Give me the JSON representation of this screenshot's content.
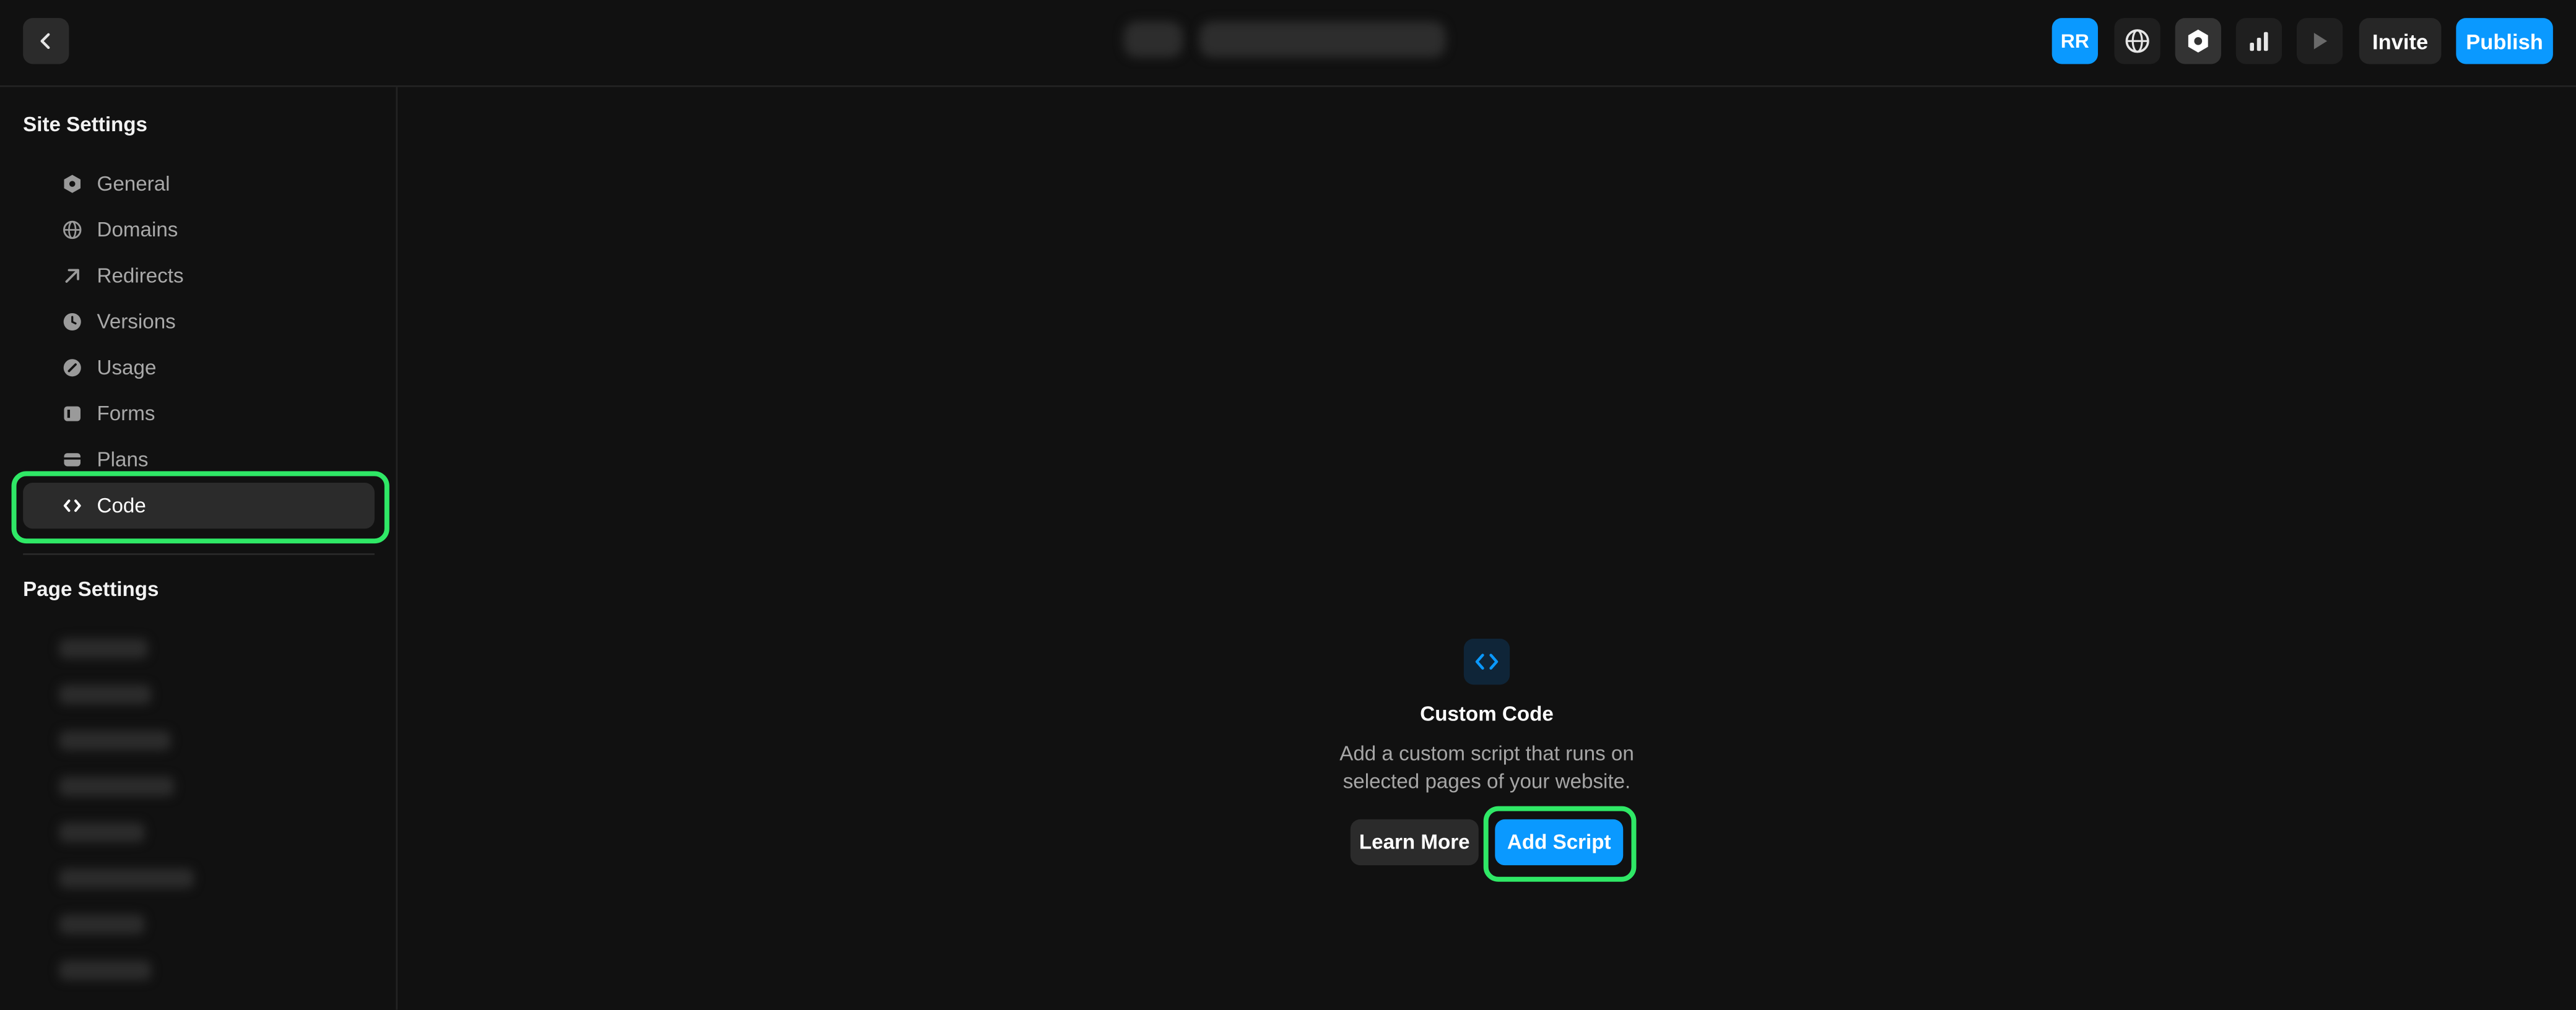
{
  "header": {
    "avatar_initials": "RR",
    "invite_label": "Invite",
    "publish_label": "Publish",
    "icons": [
      "back-icon",
      "globe-icon",
      "settings-hexagon-icon",
      "analytics-bars-icon",
      "preview-play-icon"
    ]
  },
  "sidebar": {
    "site_settings_title": "Site Settings",
    "items": [
      {
        "label": "General",
        "icon": "hexagon-icon"
      },
      {
        "label": "Domains",
        "icon": "globe-icon"
      },
      {
        "label": "Redirects",
        "icon": "arrow-up-right-icon"
      },
      {
        "label": "Versions",
        "icon": "clock-icon"
      },
      {
        "label": "Usage",
        "icon": "gauge-icon"
      },
      {
        "label": "Forms",
        "icon": "form-icon"
      },
      {
        "label": "Plans",
        "icon": "plans-icon"
      },
      {
        "label": "Code",
        "icon": "code-icon",
        "selected": true
      }
    ],
    "page_settings_title": "Page Settings"
  },
  "empty_state": {
    "icon": "code-icon",
    "title": "Custom Code",
    "description_line1": "Add a custom script that runs on",
    "description_line2": "selected pages of your website.",
    "learn_more_label": "Learn More",
    "add_script_label": "Add Script"
  },
  "colors": {
    "background": "#111111",
    "accent": "#0a99ff",
    "highlight": "#2fe866"
  }
}
